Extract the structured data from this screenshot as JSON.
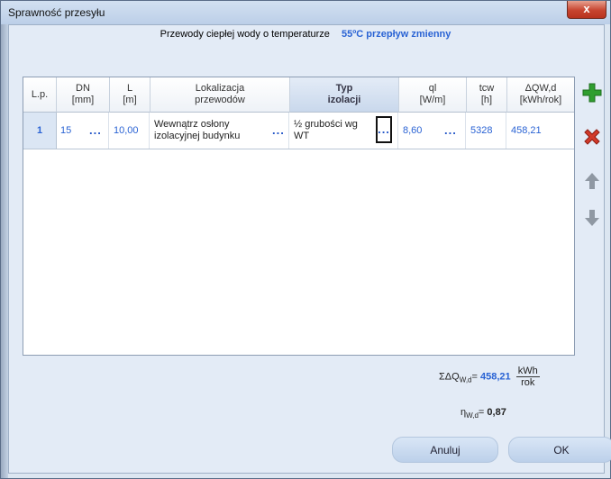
{
  "window": {
    "title": "Sprawność przesyłu",
    "close_label": "x"
  },
  "header": {
    "text": "Przewody ciepłej wody o temperaturze",
    "accent": "55ºC przepływ zmienny"
  },
  "columns": {
    "lp": "L.p.",
    "dn_1": "DN",
    "dn_2": "[mm]",
    "l_1": "L",
    "l_2": "[m]",
    "lok_1": "Lokalizacja",
    "lok_2": "przewodów",
    "typ_1": "Typ",
    "typ_2": "izolacji",
    "ql_1": "ql",
    "ql_2": "[W/m]",
    "tcw_1": "tcw",
    "tcw_2": "[h]",
    "dqw_1": "ΔQW,d",
    "dqw_2": "[kWh/rok]"
  },
  "rows": [
    {
      "lp": "1",
      "dn": "15",
      "l": "10,00",
      "lok_1": "Wewnątrz osłony",
      "lok_2": "izolacyjnej budynku",
      "typ_1": "½ grubości wg",
      "typ_2": "WT",
      "ql": "8,60",
      "tcw": "5328",
      "dqw": "458,21"
    }
  ],
  "ellipsis": "...",
  "summary": {
    "sum_label": "ΣΔQ",
    "sum_sub": "W,d",
    "sum_eq": "=",
    "sum_value": "458,21",
    "unit_num": "kWh",
    "unit_den": "rok",
    "eta_label": "η",
    "eta_sub": "W,d",
    "eta_eq": "=",
    "eta_value": "0,87"
  },
  "buttons": {
    "cancel": "Anuluj",
    "ok": "OK"
  },
  "icons": [
    "plus-icon",
    "delete-x-icon",
    "arrow-up-icon",
    "arrow-down-icon"
  ],
  "colors": {
    "accent": "#2a63d4",
    "add": "#2f9e2f",
    "delete": "#d23a2a",
    "arrow": "#8f98a3"
  }
}
